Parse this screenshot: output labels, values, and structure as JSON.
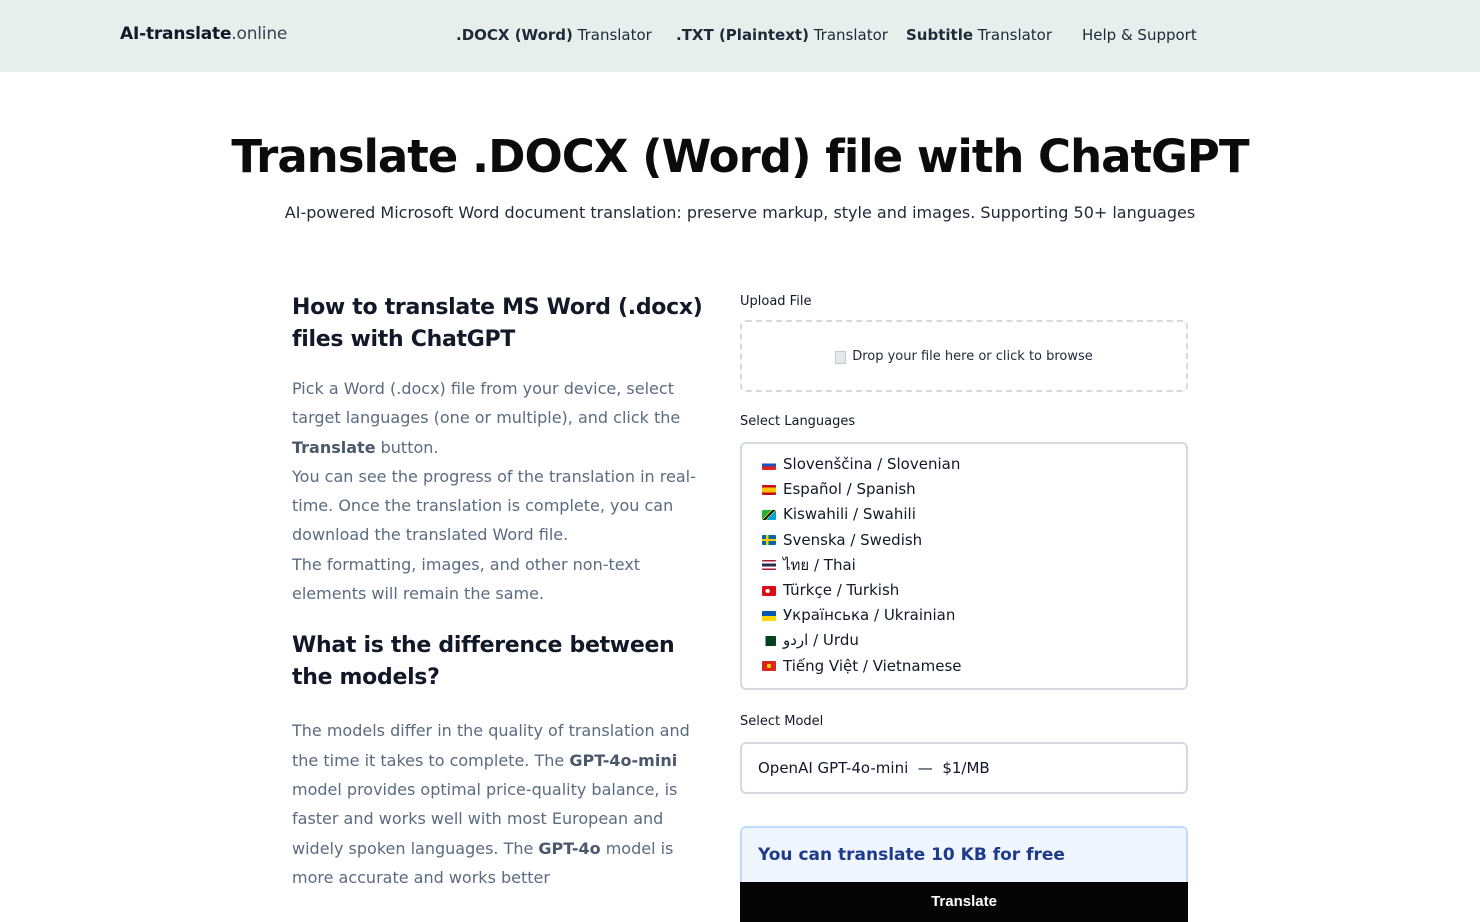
{
  "header": {
    "brand_bold": "AI-translate",
    "brand_light": ".online",
    "nav": [
      {
        "bold": ".DOCX (Word)",
        "light": " Translator"
      },
      {
        "bold": ".TXT (Plaintext)",
        "light": " Translator"
      },
      {
        "bold": "Subtitle",
        "light": " Translator"
      },
      {
        "bold": "",
        "light": "Help & Support"
      }
    ]
  },
  "hero": {
    "title": "Translate .DOCX (Word) file with ChatGPT",
    "subtitle": "AI-powered Microsoft Word document translation: preserve markup, style and images. Supporting 50+ languages"
  },
  "howto": {
    "heading": "How to translate MS Word (.docx) files with ChatGPT",
    "p1_a": "Pick a Word (.docx) file from your device, select target languages (one or multiple), and click the ",
    "p1_bold": "Translate",
    "p1_b": " button.",
    "p2": "You can see the progress of the translation in real-time. Once the translation is complete, you can download the translated Word file.",
    "p3": "The formatting, images, and other non-text elements will remain the same."
  },
  "models": {
    "heading": "What is the difference between the models?",
    "t1": "The models differ in the quality of translation and the time it takes to complete. The ",
    "b1": "GPT-4o-mini",
    "t2": " model provides optimal price-quality balance, is faster and works well with most European and widely spoken languages. The ",
    "b2": "GPT-4o",
    "t3": " model is more accurate and works better"
  },
  "form": {
    "upload_label": "Upload File",
    "dropzone_text": "Drop your file here or click to browse",
    "languages_label": "Select Languages",
    "languages": [
      {
        "text": "Slovenščina / Slovenian",
        "flag": "si"
      },
      {
        "text": "Español / Spanish",
        "flag": "es"
      },
      {
        "text": "Kiswahili / Swahili",
        "flag": "tz"
      },
      {
        "text": "Svenska / Swedish",
        "flag": "se"
      },
      {
        "text": "ไทย / Thai",
        "flag": "th"
      },
      {
        "text": "Türkçe / Turkish",
        "flag": "tr"
      },
      {
        "text": "Українська / Ukrainian",
        "flag": "ua"
      },
      {
        "text": "اردو / Urdu",
        "flag": "pk"
      },
      {
        "text": "Tiếng Việt / Vietnamese",
        "flag": "vn"
      }
    ],
    "model_label": "Select Model",
    "model_value": "OpenAI GPT-4o-mini  —  $1/MB",
    "free_notice": "You can translate 10 KB for free",
    "translate_label": "Translate"
  },
  "colors": {
    "header_bg": "#e6efec",
    "notice_bg": "#eff6ff",
    "notice_text": "#1e3a8a",
    "button_bg": "#050505"
  }
}
